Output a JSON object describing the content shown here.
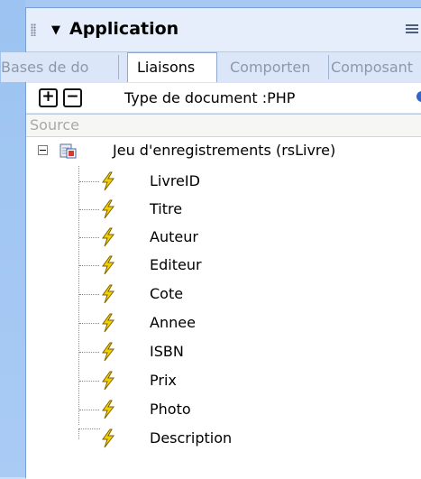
{
  "panel": {
    "title": "Application",
    "collapse_icon": "triangle-down",
    "options_icon": "options-menu-icon"
  },
  "tabs": [
    {
      "label": "Bases de do",
      "active": false
    },
    {
      "label": "Liaisons",
      "active": true
    },
    {
      "label": "Comporten",
      "active": false
    },
    {
      "label": "Composant",
      "active": false
    }
  ],
  "toolbar": {
    "add_label": "+",
    "remove_label": "−",
    "document_type": "Type de document :PHP"
  },
  "list": {
    "column_header": "Source",
    "root": {
      "label": "Jeu d'enregistrements (rsLivre)",
      "expander": "−"
    },
    "fields": [
      {
        "label": "LivreID"
      },
      {
        "label": "Titre"
      },
      {
        "label": "Auteur"
      },
      {
        "label": "Editeur"
      },
      {
        "label": "Cote"
      },
      {
        "label": "Annee"
      },
      {
        "label": "ISBN"
      },
      {
        "label": "Prix"
      },
      {
        "label": "Photo"
      },
      {
        "label": "Description"
      }
    ]
  },
  "colors": {
    "frame": "#a6c8f3",
    "panel": "#d6e4f6",
    "bolt": "#f5d000",
    "accent": "#3165c8"
  }
}
